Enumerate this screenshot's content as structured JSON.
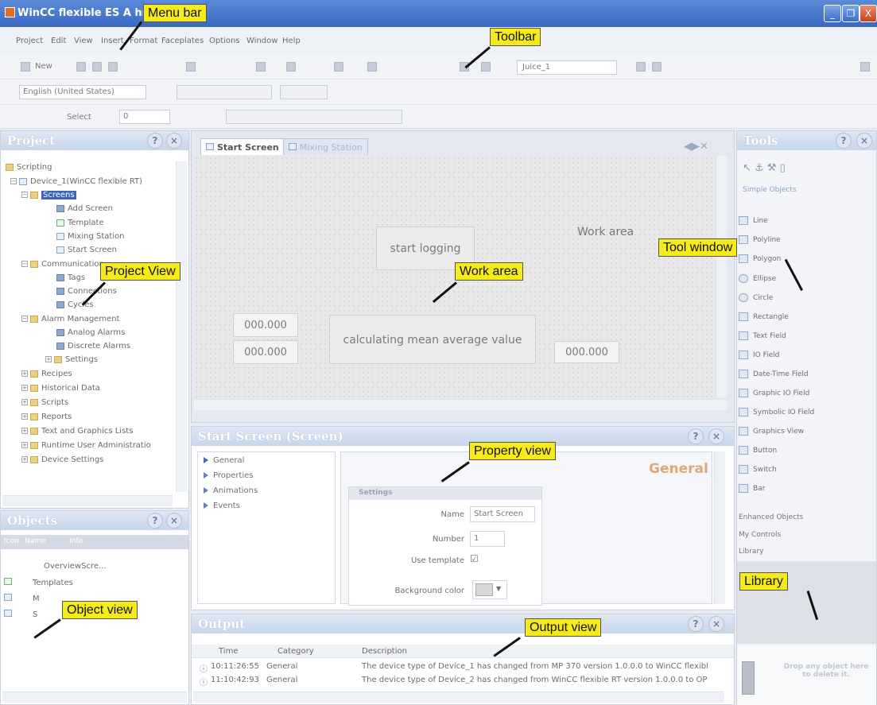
{
  "window": {
    "title": "WinCC flexible ES   A                   hmi",
    "buttons": [
      "_",
      "❐",
      "X"
    ]
  },
  "menu": {
    "items": [
      "Project",
      "Edit",
      "View",
      "Insert",
      "Format",
      "Faceplates",
      "Options",
      "Window",
      "Help"
    ]
  },
  "toolbar": {
    "new_label": "New",
    "project_combo": "Juice_1",
    "language": "English (United States)",
    "select_label": "Select",
    "number_value": "0"
  },
  "project": {
    "title": "Project",
    "tree": [
      {
        "label": "Scripting",
        "icon": "folder"
      },
      {
        "label": "Device_1(WinCC flexible RT)",
        "icon": "device"
      },
      {
        "label": "Screens",
        "icon": "folder"
      },
      {
        "label": "Add Screen",
        "icon": "add"
      },
      {
        "label": "Template",
        "icon": "screen"
      },
      {
        "label": "Mixing Station",
        "icon": "screen"
      },
      {
        "label": "Start Screen",
        "icon": "screen"
      },
      {
        "label": "Communication",
        "icon": "folder"
      },
      {
        "label": "Tags",
        "icon": "tag"
      },
      {
        "label": "Connections",
        "icon": "tag"
      },
      {
        "label": "Cycles",
        "icon": "tag"
      },
      {
        "label": "Alarm Management",
        "icon": "folder"
      },
      {
        "label": "Analog Alarms",
        "icon": "tag"
      },
      {
        "label": "Discrete Alarms",
        "icon": "tag"
      },
      {
        "label": "Settings",
        "icon": "folder"
      },
      {
        "label": "Recipes",
        "icon": "folder"
      },
      {
        "label": "Historical Data",
        "icon": "folder"
      },
      {
        "label": "Scripts",
        "icon": "folder"
      },
      {
        "label": "Reports",
        "icon": "folder"
      },
      {
        "label": "Text and Graphics Lists",
        "icon": "folder"
      },
      {
        "label": "Runtime User Administratio",
        "icon": "folder"
      },
      {
        "label": "Device Settings",
        "icon": "folder"
      }
    ]
  },
  "objects": {
    "title": "Objects",
    "columns": [
      "Icon",
      "Name",
      "Info"
    ],
    "rows": [
      "OverviewScre...",
      "Templates",
      "M",
      "S"
    ]
  },
  "editor": {
    "tabs": [
      "Start Screen",
      "Mixing Station"
    ],
    "work_area_text": "Work area",
    "start_button": "start logging",
    "calc_button": "calculating mean average value",
    "io_fields": [
      "000.000",
      "000.000",
      "000.000"
    ]
  },
  "property": {
    "title": "Start Screen (Screen)",
    "nav": [
      "General",
      "Properties",
      "Animations",
      "Events"
    ],
    "heading": "General",
    "group_title": "Settings",
    "name_label": "Name",
    "name_value": "Start Screen",
    "number_label": "Number",
    "number_value": "1",
    "template_label": "Use template",
    "template_checked": "☑",
    "bg_label": "Background color"
  },
  "output": {
    "title": "Output",
    "columns": [
      "Time",
      "Category",
      "Description"
    ],
    "rows": [
      {
        "time": "10:11:26:55",
        "category": "General",
        "description": "The device type of Device_1 has changed from MP 370 version 1.0.0.0 to WinCC flexibl"
      },
      {
        "time": "11:10:42:93",
        "category": "General",
        "description": "The device type of Device_2 has changed from WinCC flexible RT version 1.0.0.0 to OP"
      }
    ]
  },
  "tools": {
    "title": "Tools",
    "group": "Simple Objects",
    "items": [
      "Line",
      "Polyline",
      "Polygon",
      "Ellipse",
      "Circle",
      "Rectangle",
      "Text Field",
      "IO Field",
      "Date-Time Field",
      "Graphic IO Field",
      "Symbolic IO Field",
      "Graphics View",
      "Button",
      "Switch",
      "Bar"
    ],
    "groups2": [
      "Enhanced Objects",
      "My Controls",
      "Library"
    ],
    "trash_text": "Drop any object here to delete it."
  },
  "callouts": {
    "menu_bar": "Menu bar",
    "toolbar": "Toolbar",
    "project_view": "Project View",
    "work_area": "Work area",
    "tool_window": "Tool window",
    "property_view": "Property view",
    "library": "Library",
    "object_view": "Object view",
    "output_view": "Output view"
  },
  "colors": {
    "accent": "#3a68c3",
    "callout_bg": "#f5ea1a",
    "panel_header": "#c7d6ea"
  }
}
